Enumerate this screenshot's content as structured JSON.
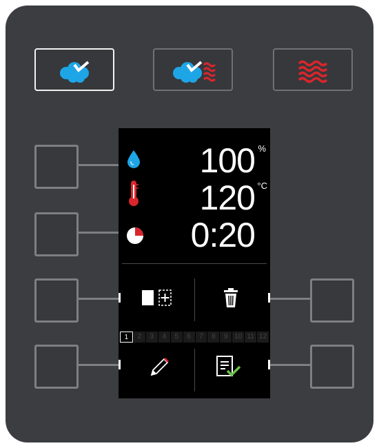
{
  "mode_buttons": [
    {
      "name": "steam-mode",
      "icon": "steam-icon",
      "active": true
    },
    {
      "name": "combi-mode",
      "icon": "steam-heat-icon",
      "active": false
    },
    {
      "name": "hot-air-mode",
      "icon": "hot-air-icon",
      "active": false
    }
  ],
  "display": {
    "humidity": {
      "value": "100",
      "unit": "%",
      "icon": "water-drop-icon"
    },
    "temperature": {
      "value": "120",
      "unit": "°C",
      "icon": "thermometer-icon"
    },
    "time": {
      "value": "0:20",
      "icon": "timer-icon"
    },
    "actions": [
      {
        "name": "add-step",
        "icon": "add-step-icon"
      },
      {
        "name": "delete",
        "icon": "trash-icon"
      },
      {
        "name": "edit",
        "icon": "pencil-icon"
      },
      {
        "name": "confirm",
        "icon": "confirm-checklist-icon"
      }
    ],
    "steps": [
      "1",
      "2",
      "3",
      "4",
      "5",
      "6",
      "7",
      "8",
      "9",
      "10",
      "11",
      "12"
    ],
    "active_step": "1"
  },
  "colors": {
    "panel": "#3b3d40",
    "steam_blue": "#1ea5e6",
    "heat_red": "#d9262c",
    "check_green": "#6cc24a"
  }
}
